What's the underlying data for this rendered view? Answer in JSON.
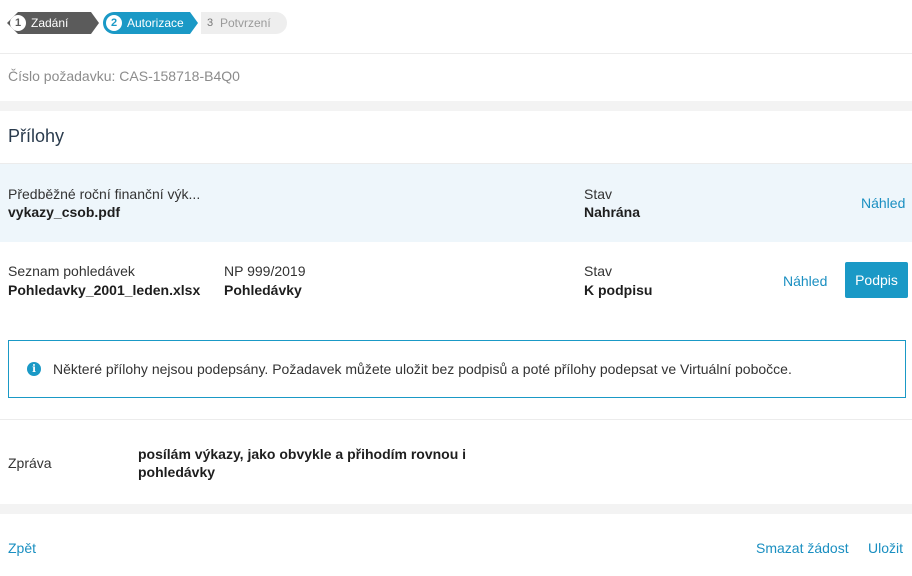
{
  "stepper": {
    "steps": [
      {
        "num": "1",
        "label": "Zadání",
        "state": "done"
      },
      {
        "num": "2",
        "label": "Autorizace",
        "state": "active"
      },
      {
        "num": "3",
        "label": "Potvrzení",
        "state": "pending"
      }
    ]
  },
  "request": {
    "number": "Číslo požadavku: CAS-158718-B4Q0"
  },
  "attachments": {
    "title": "Přílohy",
    "items": [
      {
        "name": "Předběžné roční finanční výk...",
        "file": "vykazy_csob.pdf",
        "ref_label": "",
        "ref_value": "",
        "status_label": "Stav",
        "status_value": "Nahrána",
        "preview": "Náhled"
      },
      {
        "name": "Seznam pohledávek",
        "file": "Pohledavky_2001_leden.xlsx",
        "ref_label": "NP 999/2019",
        "ref_value": "Pohledávky",
        "status_label": "Stav",
        "status_value": "K podpisu",
        "preview": "Náhled",
        "sign": "Podpis"
      }
    ]
  },
  "info": {
    "icon": "info-icon",
    "text": "Některé přílohy nejsou podepsány. Požadavek můžete uložit bez podpisů a poté přílohy podepsat ve Virtuální pobočce."
  },
  "message": {
    "label": "Zpráva",
    "line1": "posílám výkazy, jako obvykle a přihodím rovnou i",
    "line2": "pohledávky"
  },
  "footer": {
    "back": "Zpět",
    "delete": "Smazat žádost",
    "save": "Uložit"
  },
  "colors": {
    "accent": "#1a99c6",
    "done": "#5b5b5b",
    "row_highlight": "#eef6fb"
  }
}
